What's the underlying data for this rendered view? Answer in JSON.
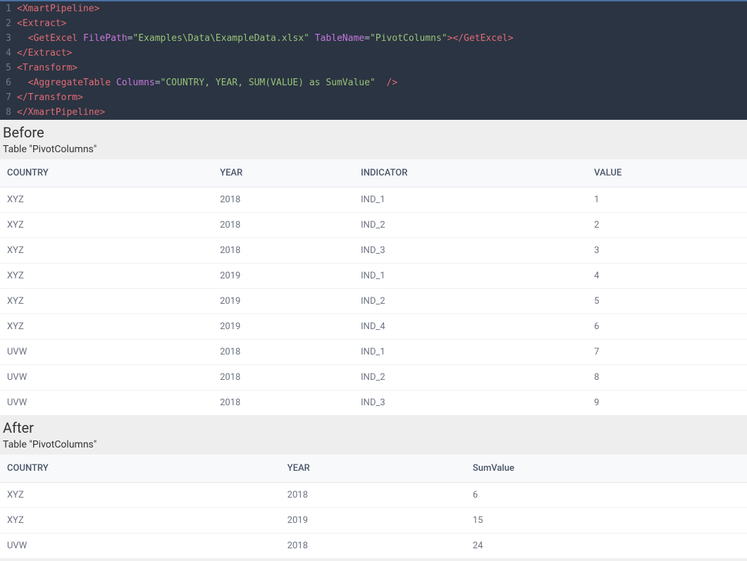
{
  "code": {
    "lines": [
      {
        "n": "1",
        "tokens": [
          {
            "t": "<",
            "c": "tag"
          },
          {
            "t": "XmartPipeline",
            "c": "tag"
          },
          {
            "t": ">",
            "c": "tag"
          }
        ]
      },
      {
        "n": "2",
        "tokens": [
          {
            "t": "<",
            "c": "tag"
          },
          {
            "t": "Extract",
            "c": "tag"
          },
          {
            "t": ">",
            "c": "tag"
          }
        ]
      },
      {
        "n": "3",
        "tokens": [
          {
            "t": "  ",
            "c": "punct"
          },
          {
            "t": "<",
            "c": "tag"
          },
          {
            "t": "GetExcel",
            "c": "tag"
          },
          {
            "t": " ",
            "c": "punct"
          },
          {
            "t": "FilePath",
            "c": "attr"
          },
          {
            "t": "=",
            "c": "punct"
          },
          {
            "t": "\"Examples\\Data\\ExampleData.xlsx\"",
            "c": "string"
          },
          {
            "t": " ",
            "c": "punct"
          },
          {
            "t": "TableName",
            "c": "attr"
          },
          {
            "t": "=",
            "c": "punct"
          },
          {
            "t": "\"PivotColumns\"",
            "c": "string"
          },
          {
            "t": ">",
            "c": "tag"
          },
          {
            "t": "</",
            "c": "tag"
          },
          {
            "t": "GetExcel",
            "c": "tag"
          },
          {
            "t": ">",
            "c": "tag"
          }
        ]
      },
      {
        "n": "4",
        "tokens": [
          {
            "t": "</",
            "c": "tag"
          },
          {
            "t": "Extract",
            "c": "tag"
          },
          {
            "t": ">",
            "c": "tag"
          }
        ]
      },
      {
        "n": "5",
        "tokens": [
          {
            "t": "<",
            "c": "tag"
          },
          {
            "t": "Transform",
            "c": "tag"
          },
          {
            "t": ">",
            "c": "tag"
          }
        ]
      },
      {
        "n": "6",
        "tokens": [
          {
            "t": "  ",
            "c": "punct"
          },
          {
            "t": "<",
            "c": "tag"
          },
          {
            "t": "AggregateTable",
            "c": "tag"
          },
          {
            "t": " ",
            "c": "punct"
          },
          {
            "t": "Columns",
            "c": "attr"
          },
          {
            "t": "=",
            "c": "punct"
          },
          {
            "t": "\"COUNTRY, YEAR, SUM(VALUE) as SumValue\"",
            "c": "string"
          },
          {
            "t": "  ",
            "c": "punct"
          },
          {
            "t": "/>",
            "c": "tag"
          }
        ]
      },
      {
        "n": "7",
        "tokens": [
          {
            "t": "</",
            "c": "tag"
          },
          {
            "t": "Transform",
            "c": "tag"
          },
          {
            "t": ">",
            "c": "tag"
          }
        ]
      },
      {
        "n": "8",
        "tokens": [
          {
            "t": "</",
            "c": "tag"
          },
          {
            "t": "XmartPipeline",
            "c": "tag"
          },
          {
            "t": ">",
            "c": "tag"
          }
        ]
      }
    ]
  },
  "before": {
    "heading": "Before",
    "caption": "Table \"PivotColumns\"",
    "columns": [
      "COUNTRY",
      "YEAR",
      "INDICATOR",
      "VALUE"
    ],
    "rows": [
      [
        "XYZ",
        "2018",
        "IND_1",
        "1"
      ],
      [
        "XYZ",
        "2018",
        "IND_2",
        "2"
      ],
      [
        "XYZ",
        "2018",
        "IND_3",
        "3"
      ],
      [
        "XYZ",
        "2019",
        "IND_1",
        "4"
      ],
      [
        "XYZ",
        "2019",
        "IND_2",
        "5"
      ],
      [
        "XYZ",
        "2019",
        "IND_4",
        "6"
      ],
      [
        "UVW",
        "2018",
        "IND_1",
        "7"
      ],
      [
        "UVW",
        "2018",
        "IND_2",
        "8"
      ],
      [
        "UVW",
        "2018",
        "IND_3",
        "9"
      ]
    ]
  },
  "after": {
    "heading": "After",
    "caption": "Table \"PivotColumns\"",
    "columns": [
      "COUNTRY",
      "YEAR",
      "SumValue"
    ],
    "rows": [
      [
        "XYZ",
        "2018",
        "6"
      ],
      [
        "XYZ",
        "2019",
        "15"
      ],
      [
        "UVW",
        "2018",
        "24"
      ]
    ]
  }
}
